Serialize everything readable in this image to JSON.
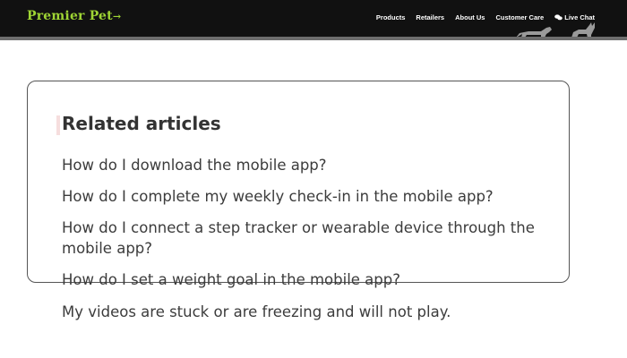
{
  "brand": {
    "name_part1": "Premier Pet",
    "flourish": "→"
  },
  "nav": {
    "products": "Products",
    "retailers": "Retailers",
    "about": "About Us",
    "care": "Customer Care",
    "chat": "Live Chat"
  },
  "related": {
    "heading": "Related articles",
    "articles": [
      "How do I download the mobile app?",
      "How do I complete my weekly check-in in the mobile app?",
      "How do I connect a step tracker or wearable device through the mobile app?",
      "How do I set a weight goal in the mobile app?",
      "My videos are stuck or are freezing and will not play."
    ]
  },
  "colors": {
    "nav_bg": "#111111",
    "brand_green": "#9fd534",
    "card_border": "#555555",
    "text": "#3c3c3c"
  },
  "icons": [
    "chat-bubbles-icon",
    "cat-dog-silhouette-icon"
  ]
}
